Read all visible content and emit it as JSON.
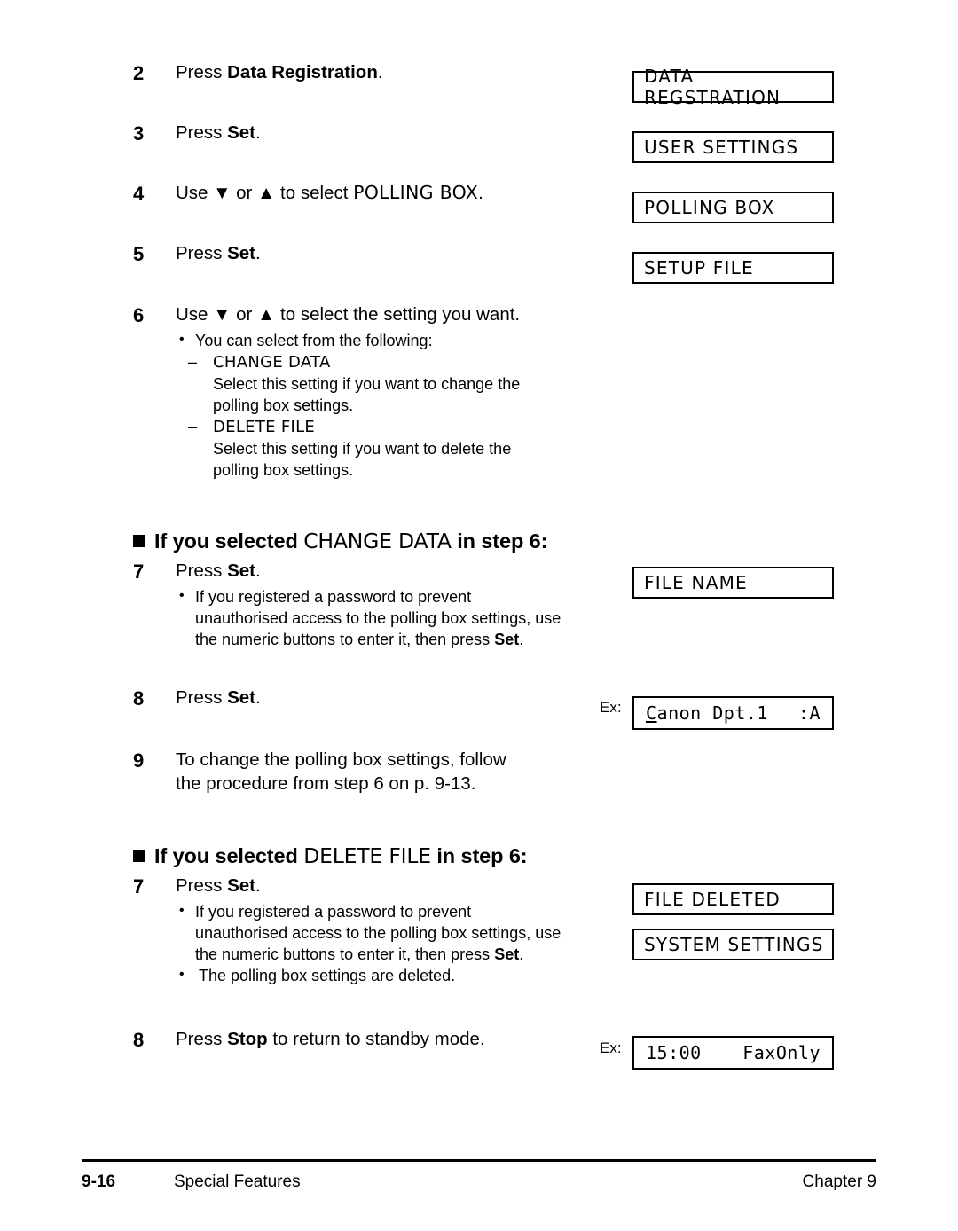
{
  "steps": {
    "s2": {
      "num": "2",
      "pre": "Press ",
      "bold": "Data Registration",
      "post": "."
    },
    "s3": {
      "num": "3",
      "pre": "Press ",
      "bold": "Set",
      "post": "."
    },
    "s4": {
      "num": "4",
      "text": "Use ▼ or ▲ to select ",
      "lcd": "POLLING BOX",
      "post": "."
    },
    "s5": {
      "num": "5",
      "pre": "Press ",
      "bold": "Set",
      "post": "."
    },
    "s6": {
      "num": "6",
      "text": "Use ▼ or ▲ to select the setting you want.",
      "bullet_intro": "You can select from the following:",
      "options": [
        {
          "name": "CHANGE DATA",
          "desc": "Select this setting if you want to change the polling box settings."
        },
        {
          "name": "DELETE FILE",
          "desc": "Select this setting if you want to delete the polling box settings."
        }
      ]
    },
    "s7a": {
      "num": "7",
      "pre": "Press ",
      "bold": "Set",
      "post": ".",
      "note_pre": "If you registered a password to prevent unauthorised access to the polling box settings, use the numeric buttons to enter it, then press ",
      "note_bold": "Set",
      "note_post": "."
    },
    "s8a": {
      "num": "8",
      "pre": "Press ",
      "bold": "Set",
      "post": "."
    },
    "s9": {
      "num": "9",
      "text": "To change the polling box settings, follow the procedure from step 6 on p. 9-13."
    },
    "s7b": {
      "num": "7",
      "pre": "Press ",
      "bold": "Set",
      "post": ".",
      "note_pre": "If you registered a password to prevent unauthorised access to the polling box settings, use the numeric buttons to enter it, then press ",
      "note_bold": "Set",
      "note_post": ".",
      "note2": "The polling box settings are deleted."
    },
    "s8b": {
      "num": "8",
      "pre": "Press ",
      "bold": "Stop",
      "post": " to return to standby mode."
    }
  },
  "headings": {
    "change_data": {
      "bold1": "If you selected ",
      "lcd": "CHANGE DATA",
      "bold2": " in step 6:"
    },
    "delete_file": {
      "bold1": "If you selected ",
      "lcd": "DELETE FILE",
      "bold2": " in step 6:"
    }
  },
  "displays": {
    "data_registration": "DATA REGSTRATION",
    "user_settings": "USER SETTINGS",
    "polling_box": "POLLING BOX",
    "setup_file": "SETUP FILE",
    "file_name": "FILE NAME",
    "file_deleted": "FILE DELETED",
    "system_settings": "SYSTEM SETTINGS",
    "ex_label": "Ex:",
    "ex_file": {
      "cursor": "C",
      "rest": "anon Dpt.1",
      "right": ":A"
    },
    "ex_standby": {
      "left": "15:00",
      "right": "FaxOnly"
    }
  },
  "footer": {
    "page_number": "9-16",
    "section": "Special Features",
    "chapter": "Chapter 9"
  }
}
